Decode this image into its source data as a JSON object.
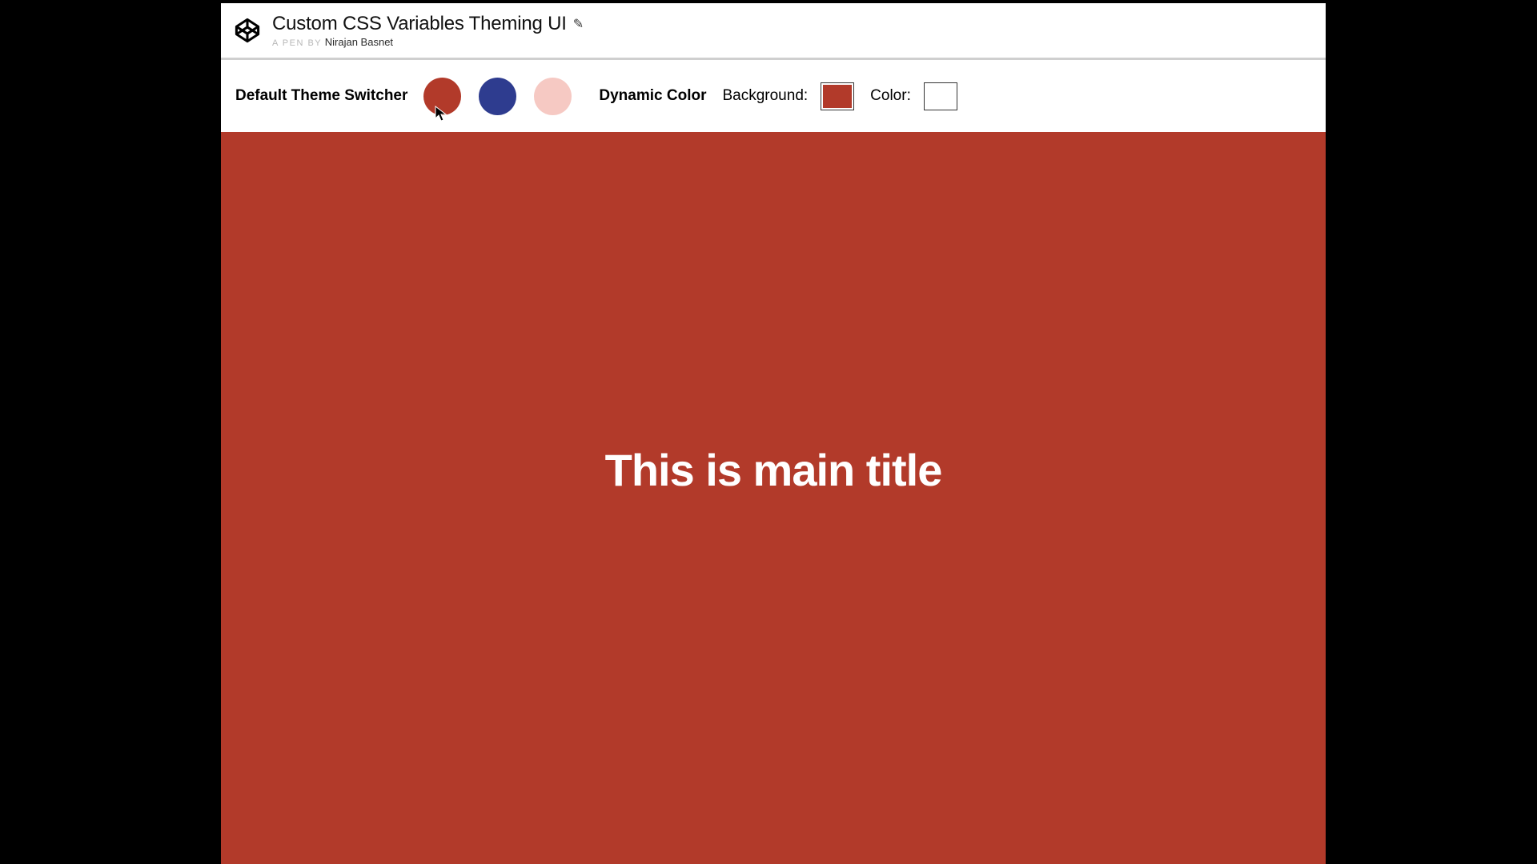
{
  "header": {
    "title": "Custom CSS Variables Theming UI",
    "byline_prefix": "A PEN BY",
    "author": "Nirajan Basnet"
  },
  "controls": {
    "theme_switcher_label": "Default Theme Switcher",
    "swatches": [
      {
        "name": "red-theme",
        "color": "#b23a2a"
      },
      {
        "name": "blue-theme",
        "color": "#2e3c8f"
      },
      {
        "name": "pink-theme",
        "color": "#f6c9c3"
      }
    ],
    "dynamic_label": "Dynamic Color",
    "background_label": "Background:",
    "background_value": "#b23a2a",
    "color_label": "Color:",
    "color_value": "#ffffff"
  },
  "main": {
    "title": "This is main title",
    "background": "#b23a2a",
    "text_color": "#ffffff"
  }
}
